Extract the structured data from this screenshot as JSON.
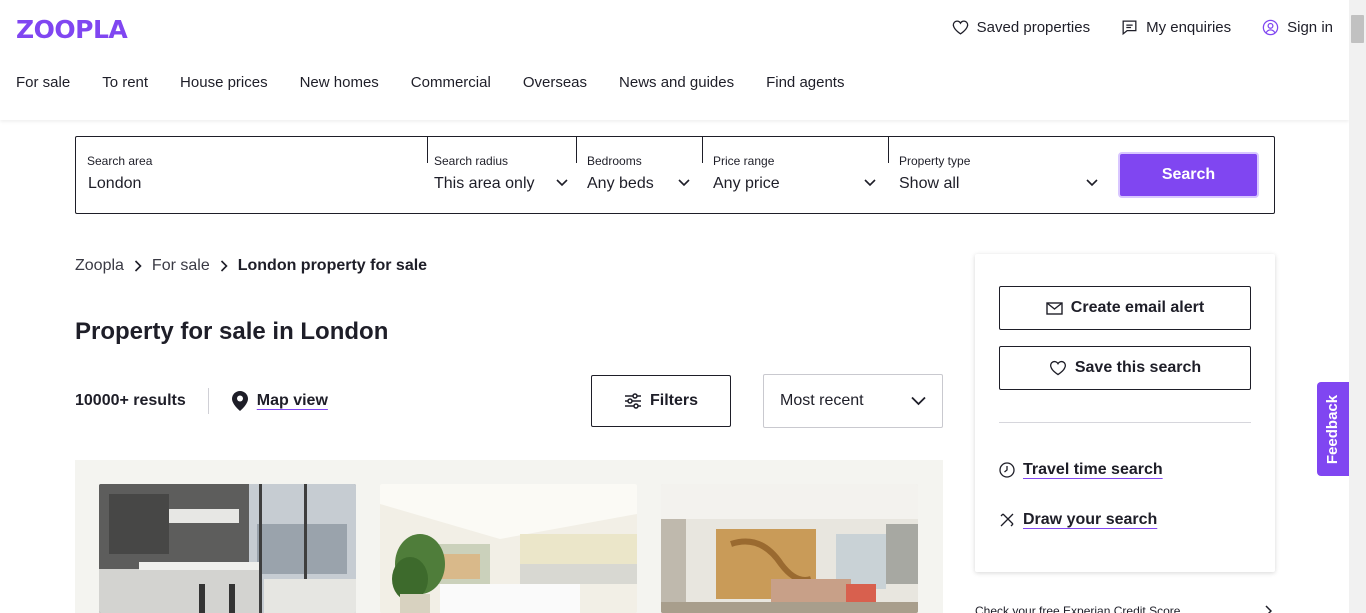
{
  "brand": {
    "logo": "ZOOPLA",
    "color": "#8046f1"
  },
  "top_links": [
    {
      "label": "Saved properties",
      "icon": "heart-icon"
    },
    {
      "label": "My enquiries",
      "icon": "message-icon"
    },
    {
      "label": "Sign in",
      "icon": "user-icon"
    }
  ],
  "nav": [
    "For sale",
    "To rent",
    "House prices",
    "New homes",
    "Commercial",
    "Overseas",
    "News and guides",
    "Find agents"
  ],
  "search": {
    "area_label": "Search area",
    "area_value": "London",
    "radius_label": "Search radius",
    "radius_value": "This area only",
    "bedrooms_label": "Bedrooms",
    "bedrooms_value": "Any beds",
    "price_label": "Price range",
    "price_value": "Any price",
    "type_label": "Property type",
    "type_value": "Show all",
    "button": "Search"
  },
  "breadcrumb": [
    "Zoopla",
    "For sale",
    "London property for sale"
  ],
  "page_title": "Property for sale in London",
  "results": {
    "count": "10000+ results",
    "map_view": "Map view",
    "filters": "Filters",
    "sort": "Most recent"
  },
  "side_panel": {
    "email_alert": "Create email alert",
    "save_search": "Save this search",
    "travel_time": "Travel time search",
    "draw_search": "Draw your search"
  },
  "credit_link": "Check your free Experian Credit Score",
  "feedback": "Feedback"
}
